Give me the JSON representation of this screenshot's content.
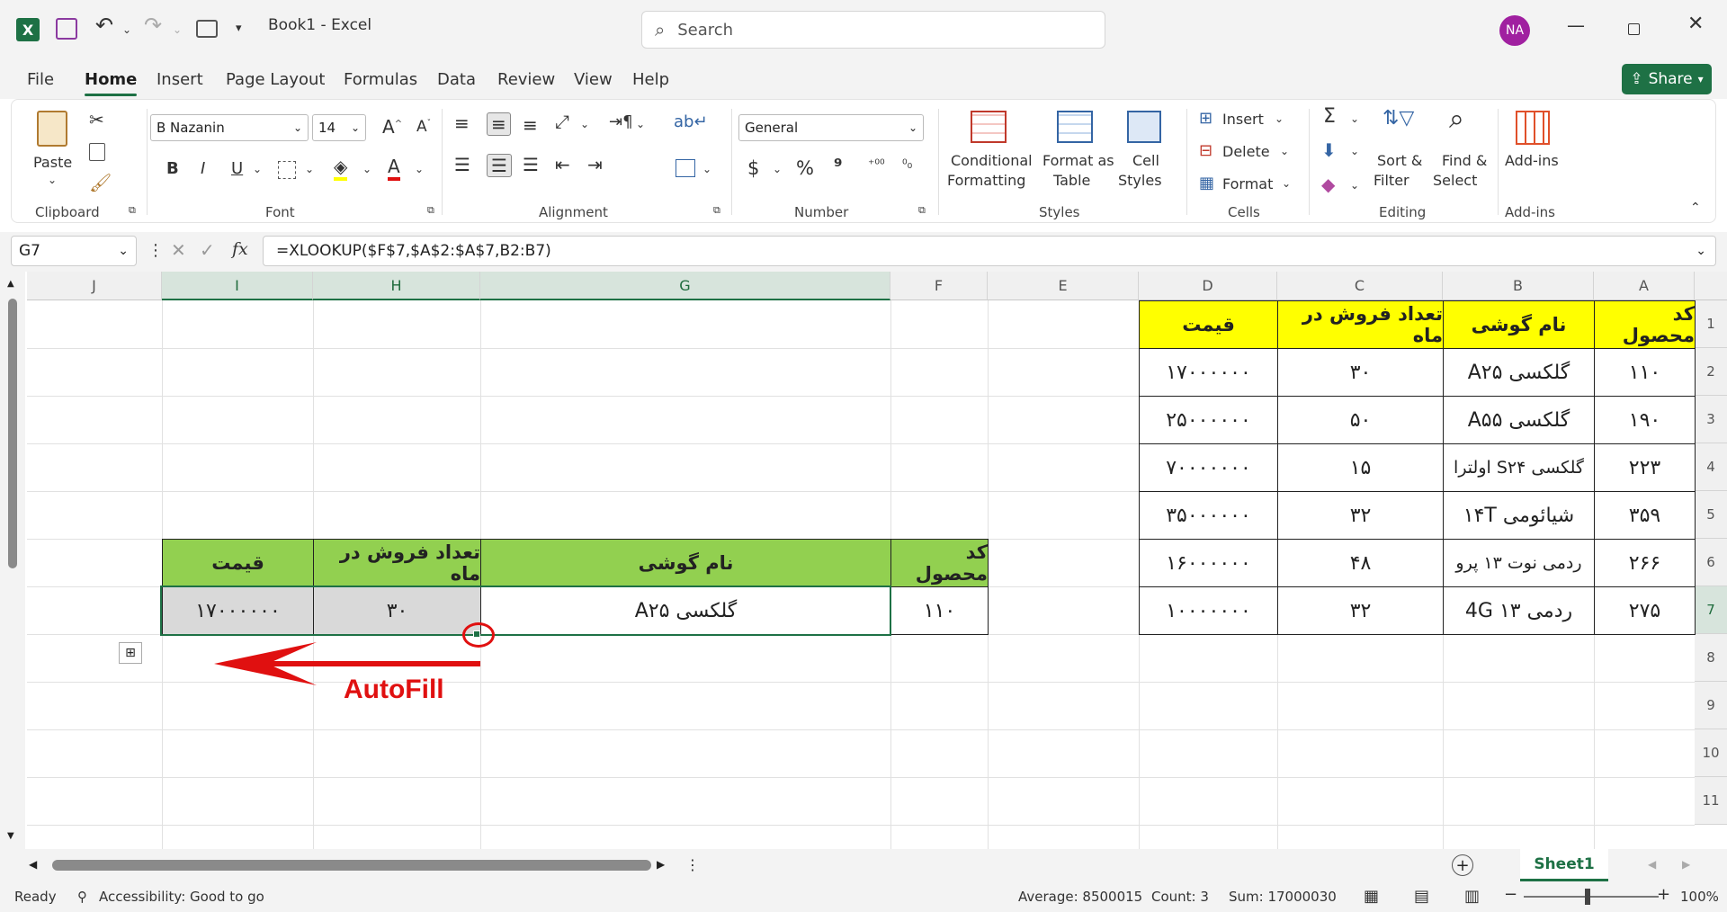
{
  "titlebar": {
    "title": "Book1  -  Excel",
    "search_placeholder": "Search",
    "avatar": "NA"
  },
  "menu": [
    "File",
    "Home",
    "Insert",
    "Page Layout",
    "Formulas",
    "Data",
    "Review",
    "View",
    "Help"
  ],
  "share_label": "Share",
  "ribbon": {
    "paste": "Paste",
    "font_name": "B Nazanin",
    "font_size": "14",
    "number_format": "General",
    "conditional": [
      "Conditional",
      "Formatting"
    ],
    "format_table": [
      "Format as",
      "Table"
    ],
    "cell_styles": [
      "Cell",
      "Styles"
    ],
    "insert": "Insert",
    "delete": "Delete",
    "format": "Format",
    "sort": [
      "Sort &",
      "Filter"
    ],
    "find": [
      "Find &",
      "Select"
    ],
    "addins": "Add-ins",
    "groups": {
      "clipboard": "Clipboard",
      "font": "Font",
      "alignment": "Alignment",
      "number": "Number",
      "styles": "Styles",
      "cells": "Cells",
      "editing": "Editing",
      "addins": "Add-ins"
    }
  },
  "formula": {
    "name_box": "G7",
    "fx": "fx",
    "value": "=XLOOKUP($F$7,$A$2:$A$7,B2:B7)"
  },
  "columns": [
    "J",
    "I",
    "H",
    "G",
    "F",
    "E",
    "D",
    "C",
    "B",
    "A"
  ],
  "rows": [
    "1",
    "2",
    "3",
    "4",
    "5",
    "6",
    "7",
    "8",
    "9",
    "10",
    "11"
  ],
  "source_table": {
    "headers": [
      "قیمت",
      "تعداد فروش در ماه",
      "نام گوشی",
      "کد محصول"
    ],
    "rows": [
      [
        "۱۷۰۰۰۰۰۰",
        "۳۰",
        "گلکسی A۲۵",
        "۱۱۰"
      ],
      [
        "۲۵۰۰۰۰۰۰",
        "۵۰",
        "گلکسی A۵۵",
        "۱۹۰"
      ],
      [
        "۷۰۰۰۰۰۰۰",
        "۱۵",
        "گلکسی S۲۴ اولترا",
        "۲۲۳"
      ],
      [
        "۳۵۰۰۰۰۰۰",
        "۳۲",
        "شیائومی ۱۴T",
        "۳۵۹"
      ],
      [
        "۱۶۰۰۰۰۰۰",
        "۴۸",
        "ردمی نوت ۱۳ پرو",
        "۲۶۶"
      ],
      [
        "۱۰۰۰۰۰۰۰",
        "۳۲",
        "ردمی ۱۳ 4G",
        "۲۷۵"
      ]
    ]
  },
  "lookup_table": {
    "headers": [
      "قیمت",
      "تعداد فروش در ماه",
      "نام گوشی",
      "کد محصول"
    ],
    "row": [
      "۱۷۰۰۰۰۰۰",
      "۳۰",
      "گلکسی A۲۵",
      "۱۱۰"
    ]
  },
  "annotation": "AutoFill",
  "sheet_tab": "Sheet1",
  "status": {
    "ready": "Ready",
    "accessibility": "Accessibility: Good to go",
    "average": "Average: 8500015",
    "count": "Count: 3",
    "sum": "Sum: 17000030",
    "zoom": "100%"
  },
  "colors": {
    "accent": "#1e7145",
    "yellow": "#ffff00",
    "green": "#92d050",
    "annot": "#e01010"
  }
}
